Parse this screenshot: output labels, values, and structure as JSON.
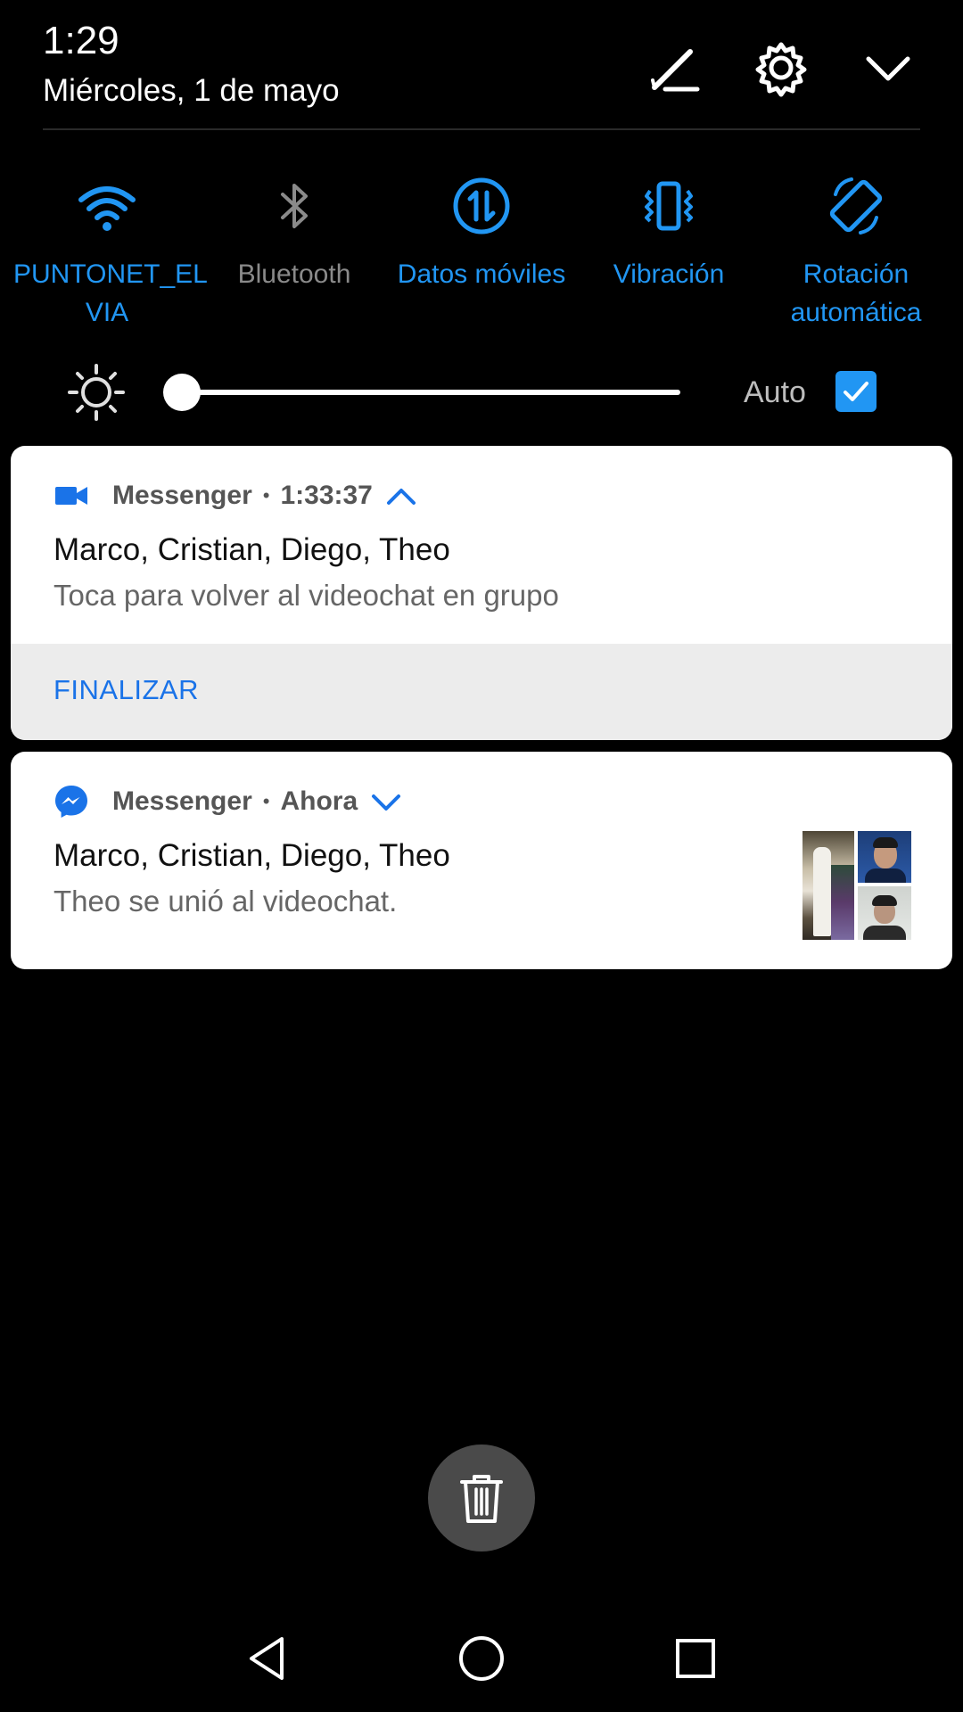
{
  "header": {
    "time": "1:29",
    "date": "Miércoles, 1 de mayo",
    "icons": [
      "edit-icon",
      "gear-icon",
      "chevron-down-icon"
    ]
  },
  "quick_settings": [
    {
      "label": "PUNTONET_EL VIA",
      "icon": "wifi-icon",
      "active": true
    },
    {
      "label": "Bluetooth",
      "icon": "bluetooth-icon",
      "active": false
    },
    {
      "label": "Datos móviles",
      "icon": "mobile-data-icon",
      "active": true
    },
    {
      "label": "Vibración",
      "icon": "vibration-icon",
      "active": true
    },
    {
      "label": "Rotación automática",
      "icon": "auto-rotate-icon",
      "active": true
    }
  ],
  "brightness": {
    "level": 0.0,
    "auto_label": "Auto",
    "auto_checked": true
  },
  "notifications": [
    {
      "app": "Messenger",
      "time": "1:33:37",
      "icon": "video-camera-icon",
      "title": "Marco, Cristian, Diego, Theo",
      "body": "Toca para volver al videochat en grupo",
      "action": "FINALIZAR",
      "expanded": true
    },
    {
      "app": "Messenger",
      "time": "Ahora",
      "icon": "messenger-icon",
      "title": "Marco, Cristian, Diego, Theo",
      "body": "Theo se unió al videochat.",
      "expanded": false
    }
  ],
  "colors": {
    "accent": "#2196f3",
    "background": "#000000",
    "inactive": "#8a8a8a",
    "action_text": "#1a73e8"
  },
  "nav": [
    "back-icon",
    "home-icon",
    "recents-icon"
  ]
}
